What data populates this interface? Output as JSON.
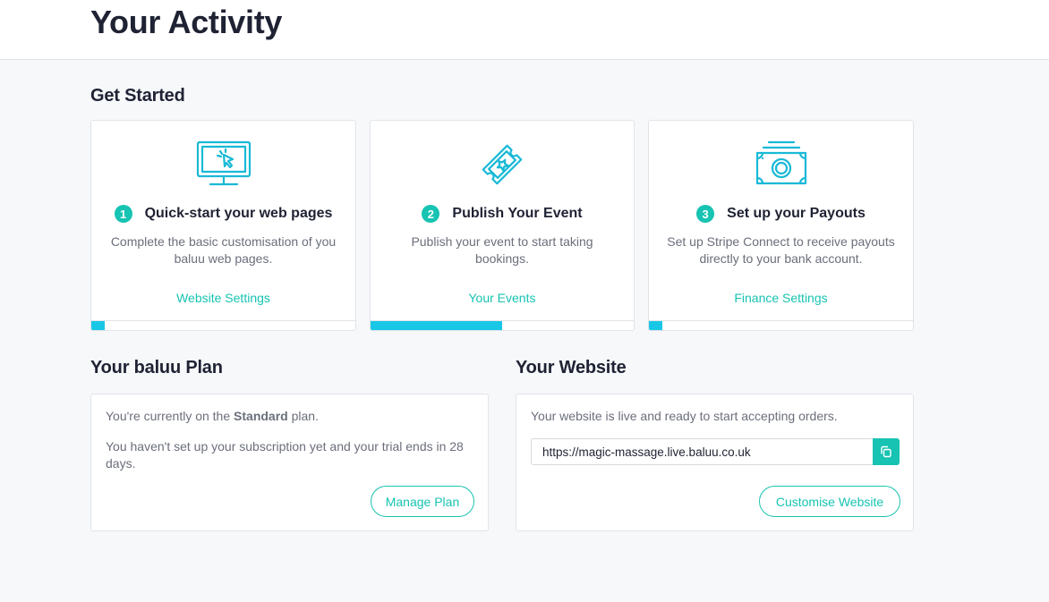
{
  "header": {
    "title": "Your Activity"
  },
  "get_started": {
    "title": "Get Started",
    "steps": [
      {
        "number": "1",
        "title": "Quick-start your web pages",
        "description": "Complete the basic customisation of you baluu web pages.",
        "link": "Website Settings",
        "icon": "monitor-cursor-icon",
        "progress": 0.05
      },
      {
        "number": "2",
        "title": "Publish Your Event",
        "description": "Publish your event to start taking bookings.",
        "link": "Your Events",
        "icon": "ticket-icon",
        "progress": 0.5
      },
      {
        "number": "3",
        "title": "Set up your Payouts",
        "description": "Set up Stripe Connect to receive payouts directly to your bank account.",
        "link": "Finance Settings",
        "icon": "money-icon",
        "progress": 0.05
      }
    ]
  },
  "plan": {
    "title": "Your baluu Plan",
    "line1_prefix": "You're currently on the",
    "plan_name": "Standard",
    "line1_suffix": "plan.",
    "trial_text": "You haven't set up your subscription yet and your trial ends in 28 days.",
    "button": "Manage Plan"
  },
  "website": {
    "title": "Your Website",
    "status_text": "Your website is live and ready to start accepting orders.",
    "url": "https://magic-massage.live.baluu.co.uk",
    "copy_icon": "copy-icon",
    "button": "Customise Website"
  },
  "colors": {
    "accent": "#17c3b2",
    "progress": "#18c7e6",
    "icon": "#18b9d6",
    "heading": "#1f2233",
    "muted": "#6b6f7b"
  }
}
